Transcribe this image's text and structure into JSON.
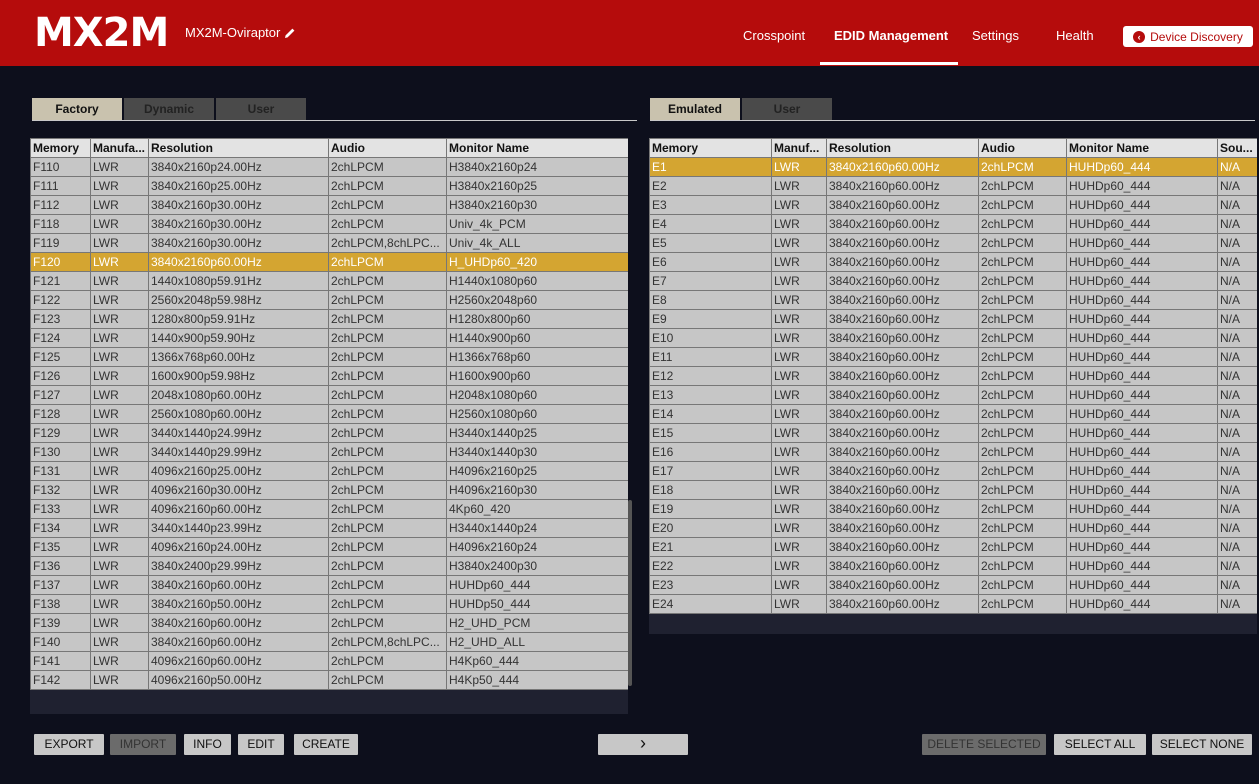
{
  "header": {
    "logo": "MX2M",
    "device_name": "MX2M-Oviraptor",
    "nav": [
      {
        "label": "Crosspoint"
      },
      {
        "label": "EDID Management"
      },
      {
        "label": "Settings"
      },
      {
        "label": "Health"
      }
    ],
    "device_discovery": "Device Discovery"
  },
  "left": {
    "tabs": [
      "Factory",
      "Dynamic",
      "User"
    ],
    "active_tab": "Factory",
    "columns": [
      "Memory",
      "Manufa...",
      "Resolution",
      "Audio",
      "Monitor Name"
    ],
    "rows": [
      [
        "F110",
        "LWR",
        "3840x2160p24.00Hz",
        "2chLPCM",
        "H3840x2160p24"
      ],
      [
        "F111",
        "LWR",
        "3840x2160p25.00Hz",
        "2chLPCM",
        "H3840x2160p25"
      ],
      [
        "F112",
        "LWR",
        "3840x2160p30.00Hz",
        "2chLPCM",
        "H3840x2160p30"
      ],
      [
        "F118",
        "LWR",
        "3840x2160p30.00Hz",
        "2chLPCM",
        "Univ_4k_PCM"
      ],
      [
        "F119",
        "LWR",
        "3840x2160p30.00Hz",
        "2chLPCM,8chLPC...",
        "Univ_4k_ALL"
      ],
      [
        "F120",
        "LWR",
        "3840x2160p60.00Hz",
        "2chLPCM",
        "H_UHDp60_420"
      ],
      [
        "F121",
        "LWR",
        "1440x1080p59.91Hz",
        "2chLPCM",
        "H1440x1080p60"
      ],
      [
        "F122",
        "LWR",
        "2560x2048p59.98Hz",
        "2chLPCM",
        "H2560x2048p60"
      ],
      [
        "F123",
        "LWR",
        "1280x800p59.91Hz",
        "2chLPCM",
        "H1280x800p60"
      ],
      [
        "F124",
        "LWR",
        "1440x900p59.90Hz",
        "2chLPCM",
        "H1440x900p60"
      ],
      [
        "F125",
        "LWR",
        "1366x768p60.00Hz",
        "2chLPCM",
        "H1366x768p60"
      ],
      [
        "F126",
        "LWR",
        "1600x900p59.98Hz",
        "2chLPCM",
        "H1600x900p60"
      ],
      [
        "F127",
        "LWR",
        "2048x1080p60.00Hz",
        "2chLPCM",
        "H2048x1080p60"
      ],
      [
        "F128",
        "LWR",
        "2560x1080p60.00Hz",
        "2chLPCM",
        "H2560x1080p60"
      ],
      [
        "F129",
        "LWR",
        "3440x1440p24.99Hz",
        "2chLPCM",
        "H3440x1440p25"
      ],
      [
        "F130",
        "LWR",
        "3440x1440p29.99Hz",
        "2chLPCM",
        "H3440x1440p30"
      ],
      [
        "F131",
        "LWR",
        "4096x2160p25.00Hz",
        "2chLPCM",
        "H4096x2160p25"
      ],
      [
        "F132",
        "LWR",
        "4096x2160p30.00Hz",
        "2chLPCM",
        "H4096x2160p30"
      ],
      [
        "F133",
        "LWR",
        "4096x2160p60.00Hz",
        "2chLPCM",
        "4Kp60_420"
      ],
      [
        "F134",
        "LWR",
        "3440x1440p23.99Hz",
        "2chLPCM",
        "H3440x1440p24"
      ],
      [
        "F135",
        "LWR",
        "4096x2160p24.00Hz",
        "2chLPCM",
        "H4096x2160p24"
      ],
      [
        "F136",
        "LWR",
        "3840x2400p29.99Hz",
        "2chLPCM",
        "H3840x2400p30"
      ],
      [
        "F137",
        "LWR",
        "3840x2160p60.00Hz",
        "2chLPCM",
        "HUHDp60_444"
      ],
      [
        "F138",
        "LWR",
        "3840x2160p50.00Hz",
        "2chLPCM",
        "HUHDp50_444"
      ],
      [
        "F139",
        "LWR",
        "3840x2160p60.00Hz",
        "2chLPCM",
        "H2_UHD_PCM"
      ],
      [
        "F140",
        "LWR",
        "3840x2160p60.00Hz",
        "2chLPCM,8chLPC...",
        "H2_UHD_ALL"
      ],
      [
        "F141",
        "LWR",
        "4096x2160p60.00Hz",
        "2chLPCM",
        "H4Kp60_444"
      ],
      [
        "F142",
        "LWR",
        "4096x2160p50.00Hz",
        "2chLPCM",
        "H4Kp50_444"
      ]
    ],
    "selected_row": "F120"
  },
  "right": {
    "tabs": [
      "Emulated",
      "User"
    ],
    "active_tab": "Emulated",
    "columns": [
      "Memory",
      "Manuf...",
      "Resolution",
      "Audio",
      "Monitor Name",
      "Sou..."
    ],
    "rows": [
      [
        "E1",
        "LWR",
        "3840x2160p60.00Hz",
        "2chLPCM",
        "HUHDp60_444",
        "N/A"
      ],
      [
        "E2",
        "LWR",
        "3840x2160p60.00Hz",
        "2chLPCM",
        "HUHDp60_444",
        "N/A"
      ],
      [
        "E3",
        "LWR",
        "3840x2160p60.00Hz",
        "2chLPCM",
        "HUHDp60_444",
        "N/A"
      ],
      [
        "E4",
        "LWR",
        "3840x2160p60.00Hz",
        "2chLPCM",
        "HUHDp60_444",
        "N/A"
      ],
      [
        "E5",
        "LWR",
        "3840x2160p60.00Hz",
        "2chLPCM",
        "HUHDp60_444",
        "N/A"
      ],
      [
        "E6",
        "LWR",
        "3840x2160p60.00Hz",
        "2chLPCM",
        "HUHDp60_444",
        "N/A"
      ],
      [
        "E7",
        "LWR",
        "3840x2160p60.00Hz",
        "2chLPCM",
        "HUHDp60_444",
        "N/A"
      ],
      [
        "E8",
        "LWR",
        "3840x2160p60.00Hz",
        "2chLPCM",
        "HUHDp60_444",
        "N/A"
      ],
      [
        "E9",
        "LWR",
        "3840x2160p60.00Hz",
        "2chLPCM",
        "HUHDp60_444",
        "N/A"
      ],
      [
        "E10",
        "LWR",
        "3840x2160p60.00Hz",
        "2chLPCM",
        "HUHDp60_444",
        "N/A"
      ],
      [
        "E11",
        "LWR",
        "3840x2160p60.00Hz",
        "2chLPCM",
        "HUHDp60_444",
        "N/A"
      ],
      [
        "E12",
        "LWR",
        "3840x2160p60.00Hz",
        "2chLPCM",
        "HUHDp60_444",
        "N/A"
      ],
      [
        "E13",
        "LWR",
        "3840x2160p60.00Hz",
        "2chLPCM",
        "HUHDp60_444",
        "N/A"
      ],
      [
        "E14",
        "LWR",
        "3840x2160p60.00Hz",
        "2chLPCM",
        "HUHDp60_444",
        "N/A"
      ],
      [
        "E15",
        "LWR",
        "3840x2160p60.00Hz",
        "2chLPCM",
        "HUHDp60_444",
        "N/A"
      ],
      [
        "E16",
        "LWR",
        "3840x2160p60.00Hz",
        "2chLPCM",
        "HUHDp60_444",
        "N/A"
      ],
      [
        "E17",
        "LWR",
        "3840x2160p60.00Hz",
        "2chLPCM",
        "HUHDp60_444",
        "N/A"
      ],
      [
        "E18",
        "LWR",
        "3840x2160p60.00Hz",
        "2chLPCM",
        "HUHDp60_444",
        "N/A"
      ],
      [
        "E19",
        "LWR",
        "3840x2160p60.00Hz",
        "2chLPCM",
        "HUHDp60_444",
        "N/A"
      ],
      [
        "E20",
        "LWR",
        "3840x2160p60.00Hz",
        "2chLPCM",
        "HUHDp60_444",
        "N/A"
      ],
      [
        "E21",
        "LWR",
        "3840x2160p60.00Hz",
        "2chLPCM",
        "HUHDp60_444",
        "N/A"
      ],
      [
        "E22",
        "LWR",
        "3840x2160p60.00Hz",
        "2chLPCM",
        "HUHDp60_444",
        "N/A"
      ],
      [
        "E23",
        "LWR",
        "3840x2160p60.00Hz",
        "2chLPCM",
        "HUHDp60_444",
        "N/A"
      ],
      [
        "E24",
        "LWR",
        "3840x2160p60.00Hz",
        "2chLPCM",
        "HUHDp60_444",
        "N/A"
      ]
    ],
    "selected_row": "E1"
  },
  "buttons": {
    "export": "EXPORT",
    "import": "IMPORT",
    "info": "INFO",
    "edit": "EDIT",
    "create": "CREATE",
    "transfer": "›",
    "delete_selected": "DELETE SELECTED",
    "select_all": "SELECT ALL",
    "select_none": "SELECT NONE"
  },
  "colors": {
    "header": "#b50c0c",
    "background": "#0d0f1c",
    "selected_row": "#d4a531",
    "row": "#c6c6c6"
  }
}
